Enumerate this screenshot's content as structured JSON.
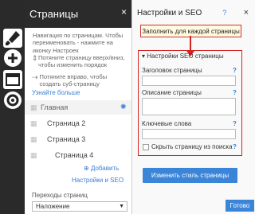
{
  "sidebar": {
    "icons": [
      "brush-icon",
      "plus-icon",
      "pages-icon",
      "gear-icon"
    ]
  },
  "pages_panel": {
    "title": "Страницы",
    "close": "×",
    "hint_navigate": "Навигация по страницам. Чтобы переименовать - нажмите на иконку Настроек",
    "hint_drag_up": "Потяните страницу вверх/вниз, чтобы изменить порядок",
    "hint_drag_right": "Потяните вправо, чтобы создать суб-страницу",
    "learn_more": "Узнайте больше",
    "tree": [
      "Главная",
      "Страница 2",
      "Страница 3",
      "Страница 4"
    ],
    "add_link": "Добавить",
    "seo_link": "Настройки и SEO",
    "transitions_label": "Переходы страниц",
    "transitions_value": "Наложение"
  },
  "settings_panel": {
    "title": "Настройки и SEO",
    "help": "?",
    "close": "×",
    "callout": "Заполнить для каждой страницы",
    "section_title": "Настройки SEO страницы",
    "fields": {
      "page_title": "Заголовок страницы",
      "page_description": "Описание страницы",
      "keywords": "Ключевые слова"
    },
    "hide_checkbox_label": "Скрыть страницу из поиска",
    "change_style_button": "Изменить стиль страницы",
    "done_button": "Готово"
  }
}
